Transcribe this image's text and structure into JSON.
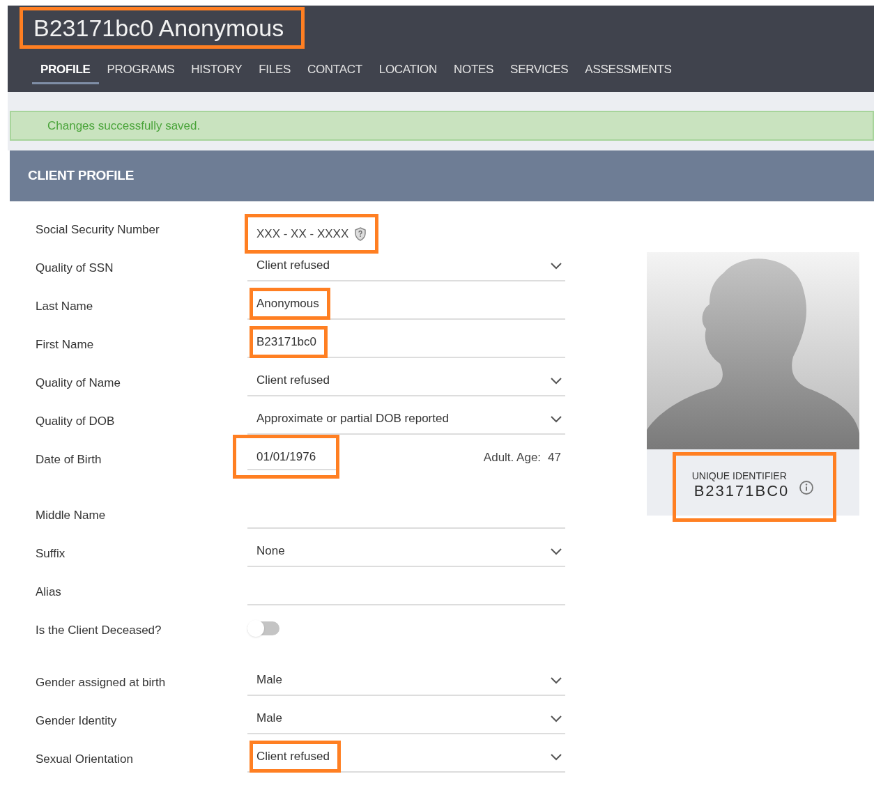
{
  "header": {
    "title": "B23171bc0 Anonymous",
    "title_highlighted": true
  },
  "tabs": [
    {
      "label": "PROFILE",
      "selected": true
    },
    {
      "label": "PROGRAMS",
      "selected": false
    },
    {
      "label": "HISTORY",
      "selected": false
    },
    {
      "label": "FILES",
      "selected": false
    },
    {
      "label": "CONTACT",
      "selected": false
    },
    {
      "label": "LOCATION",
      "selected": false
    },
    {
      "label": "NOTES",
      "selected": false
    },
    {
      "label": "SERVICES",
      "selected": false
    },
    {
      "label": "ASSESSMENTS",
      "selected": false
    }
  ],
  "alert": {
    "message": "Changes successfully saved."
  },
  "section": {
    "title": "CLIENT PROFILE"
  },
  "fields": [
    {
      "kind": "ssn",
      "label": "Social Security Number",
      "value": "XXX - XX - XXXX",
      "highlighted": true
    },
    {
      "kind": "select",
      "label": "Quality of SSN",
      "value": "Client refused"
    },
    {
      "kind": "text",
      "label": "Last Name",
      "value": "Anonymous",
      "highlighted": true
    },
    {
      "kind": "text",
      "label": "First Name",
      "value": "B23171bc0",
      "highlighted": true
    },
    {
      "kind": "select",
      "label": "Quality of Name",
      "value": "Client refused"
    },
    {
      "kind": "select",
      "label": "Quality of DOB",
      "value": "Approximate or partial DOB reported"
    },
    {
      "kind": "date",
      "label": "Date of Birth",
      "value": "01/01/1976",
      "age_label": "Adult. Age:",
      "age": "47",
      "highlighted": true
    },
    {
      "kind": "text",
      "label": "Middle Name"
    },
    {
      "kind": "select",
      "label": "Suffix",
      "value": "None"
    },
    {
      "kind": "text",
      "label": "Alias"
    },
    {
      "kind": "toggle",
      "label": "Is the Client Deceased?",
      "on": false
    },
    {
      "kind": "select",
      "label": "Gender assigned at birth",
      "value": "Male"
    },
    {
      "kind": "select",
      "label": "Gender Identity",
      "value": "Male"
    },
    {
      "kind": "select",
      "label": "Sexual Orientation",
      "value": "Client refused",
      "highlighted": true
    }
  ],
  "identifier": {
    "label": "UNIQUE IDENTIFIER",
    "value": "B23171BC0",
    "highlighted": true
  }
}
